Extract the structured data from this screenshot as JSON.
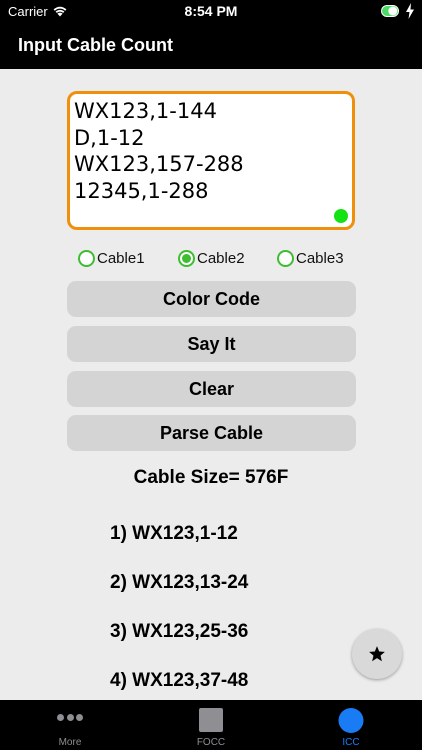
{
  "status_bar": {
    "carrier": "Carrier",
    "time": "8:54 PM"
  },
  "nav": {
    "title": "Input Cable Count"
  },
  "input": {
    "lines": [
      "WX123,1-144",
      "D,1-12",
      "WX123,157-288",
      "12345,1-288"
    ],
    "border_color": "#f0900a",
    "status_dot_color": "#15e215"
  },
  "radios": [
    {
      "label": "Cable1",
      "selected": false
    },
    {
      "label": "Cable2",
      "selected": true
    },
    {
      "label": "Cable3",
      "selected": false
    }
  ],
  "buttons": {
    "color_code": "Color Code",
    "say_it": "Say It",
    "clear": "Clear",
    "parse_cable": "Parse Cable"
  },
  "cable_size": "Cable Size= 576F",
  "results": [
    "1) WX123,1-12",
    "2) WX123,13-24",
    "3) WX123,25-36",
    "4) WX123,37-48"
  ],
  "fab": {
    "icon": "star-icon"
  },
  "tabs": [
    {
      "label": "More",
      "icon": "more-dots-icon",
      "active": false
    },
    {
      "label": "FOCC",
      "icon": "square-icon",
      "active": false
    },
    {
      "label": "ICC",
      "icon": "circle-icon",
      "active": true
    }
  ],
  "colors": {
    "accent_blue": "#1a7cf5",
    "radio_green": "#3dbd2f",
    "toggle_green": "#4cd964"
  }
}
